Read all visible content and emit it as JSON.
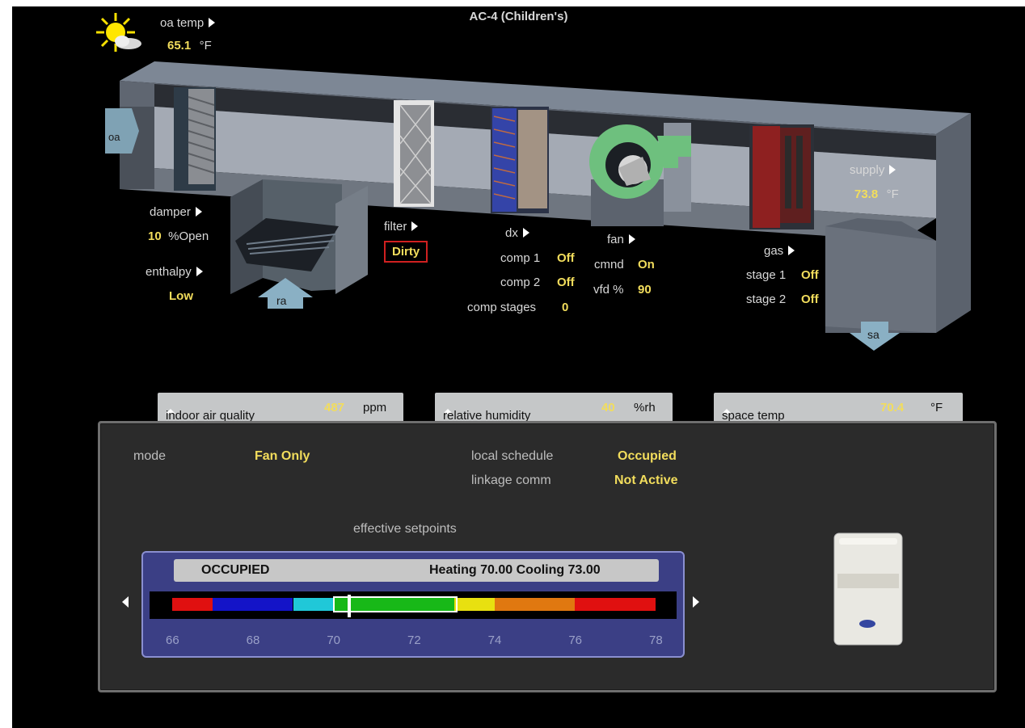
{
  "title": "AC-4 (Children's)",
  "oa_temp": {
    "label": "oa temp",
    "value": "65.1",
    "unit": "°F"
  },
  "duct_labels": {
    "oa": "oa",
    "ra": "ra",
    "sa": "sa"
  },
  "damper": {
    "label": "damper",
    "value": "10",
    "unit": "%Open"
  },
  "enthalpy": {
    "label": "enthalpy",
    "value": "Low"
  },
  "filter": {
    "label": "filter",
    "value": "Dirty"
  },
  "dx": {
    "label": "dx",
    "comp1_label": "comp 1",
    "comp1_value": "Off",
    "comp2_label": "comp 2",
    "comp2_value": "Off",
    "stages_label": "comp stages",
    "stages_value": "0"
  },
  "fan": {
    "label": "fan",
    "cmnd_label": "cmnd",
    "cmnd_value": "On",
    "vfd_label": "vfd %",
    "vfd_value": "90"
  },
  "gas": {
    "label": "gas",
    "stage1_label": "stage 1",
    "stage1_value": "Off",
    "stage2_label": "stage 2",
    "stage2_value": "Off"
  },
  "supply": {
    "label": "supply",
    "value": "73.8",
    "unit": "°F"
  },
  "tabs": [
    {
      "label": "indoor air quality",
      "value": "487",
      "unit": "ppm"
    },
    {
      "label": "relative humidity",
      "value": "40",
      "unit": "%rh"
    },
    {
      "label": "space temp",
      "value": "70.4",
      "unit": "°F"
    }
  ],
  "panel": {
    "mode_label": "mode",
    "mode_value": "Fan Only",
    "schedule_label": "local schedule",
    "schedule_value": "Occupied",
    "linkage_label": "linkage comm",
    "linkage_value": "Not Active",
    "setpoints_label": "effective setpoints"
  },
  "setpoints": {
    "state": "OCCUPIED",
    "heating_label": "Heating",
    "heating_value": "70.00",
    "cooling_label": "Cooling",
    "cooling_value": "73.00",
    "current_temp": 70.4,
    "scale_min": 66,
    "scale_max": 78,
    "ticks": [
      "66",
      "68",
      "70",
      "72",
      "74",
      "76",
      "78"
    ],
    "bands": [
      {
        "from": 66,
        "to": 67,
        "color": "#e01010"
      },
      {
        "from": 67,
        "to": 69,
        "color": "#1414c8"
      },
      {
        "from": 69,
        "to": 70,
        "color": "#20c8d8"
      },
      {
        "from": 70,
        "to": 73,
        "color": "#18b818"
      },
      {
        "from": 73,
        "to": 74,
        "color": "#e8e010"
      },
      {
        "from": 74,
        "to": 76,
        "color": "#e07810"
      },
      {
        "from": 76,
        "to": 78,
        "color": "#e01010"
      }
    ]
  }
}
